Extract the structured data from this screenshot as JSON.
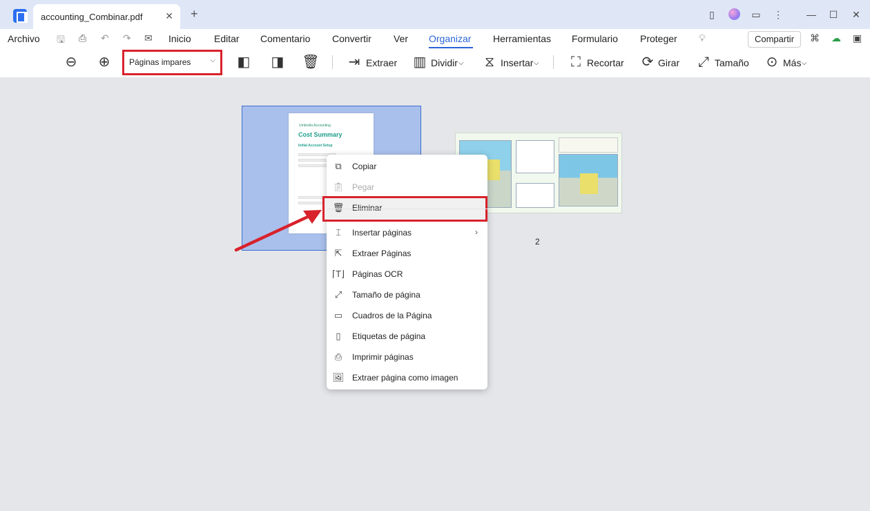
{
  "titlebar": {
    "tab_title": "accounting_Combinar.pdf",
    "close": "✕",
    "new_tab": "+"
  },
  "menubar": {
    "items": [
      "Archivo",
      "Inicio",
      "Editar",
      "Comentario",
      "Convertir",
      "Ver",
      "Organizar",
      "Herramientas",
      "Formulario",
      "Proteger"
    ],
    "active": "Organizar",
    "share": "Compartir"
  },
  "toolbar": {
    "select_value": "Páginas impares",
    "extract": "Extraer",
    "split": "Dividir",
    "insert": "Insertar",
    "crop": "Recortar",
    "rotate": "Girar",
    "size": "Tamaño",
    "more": "Más"
  },
  "page1": {
    "brand": "Umbrella Accounting",
    "title": "Cost Summary",
    "subtitle": "Initial Account Setup"
  },
  "page2": {
    "number": "2"
  },
  "context_menu": {
    "items": [
      {
        "label": "Copiar",
        "icon": "copy-icon",
        "enabled": true
      },
      {
        "label": "Pegar",
        "icon": "paste-icon",
        "enabled": false
      },
      {
        "label": "Eliminar",
        "icon": "trash-icon",
        "enabled": true
      },
      {
        "label": "Insertar páginas",
        "icon": "insert-pages-icon",
        "enabled": true,
        "submenu": "›"
      },
      {
        "label": "Extraer Páginas",
        "icon": "extract-pages-icon",
        "enabled": true
      },
      {
        "label": "Páginas OCR",
        "icon": "ocr-icon",
        "enabled": true
      },
      {
        "label": "Tamaño de página",
        "icon": "page-size-icon",
        "enabled": true
      },
      {
        "label": "Cuadros de la Página",
        "icon": "page-boxes-icon",
        "enabled": true
      },
      {
        "label": "Etiquetas de página",
        "icon": "page-labels-icon",
        "enabled": true
      },
      {
        "label": "Imprimir páginas",
        "icon": "print-icon",
        "enabled": true
      },
      {
        "label": "Extraer página como imagen",
        "icon": "image-icon",
        "enabled": true
      }
    ]
  },
  "colors": {
    "accent": "#2b64d8",
    "highlight": "#d8222c",
    "selection": "#a9c0ec"
  }
}
